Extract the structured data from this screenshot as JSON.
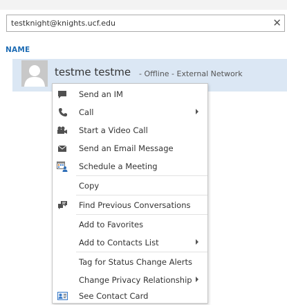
{
  "search": {
    "value": "testknight@knights.ucf.edu",
    "clear_glyph": "✕"
  },
  "section": {
    "title": "NAME"
  },
  "contact": {
    "name": "testme testme",
    "status": "- Offline - External Network"
  },
  "menu": {
    "items": [
      {
        "label": "Send an IM",
        "icon": "chat-icon",
        "submenu": false
      },
      {
        "label": "Call",
        "icon": "phone-icon",
        "submenu": true
      },
      {
        "label": "Start a Video Call",
        "icon": "video-camera-icon",
        "submenu": false
      },
      {
        "label": "Send an Email Message",
        "icon": "envelope-icon",
        "submenu": false
      },
      {
        "label": "Schedule a Meeting",
        "icon": "calendar-meeting-icon",
        "submenu": false
      },
      {
        "label": "Copy",
        "icon": "",
        "submenu": false
      },
      {
        "label": "Find Previous Conversations",
        "icon": "conversation-history-icon",
        "submenu": false
      },
      {
        "label": "Add to Favorites",
        "icon": "",
        "submenu": false
      },
      {
        "label": "Add to Contacts List",
        "icon": "",
        "submenu": true
      },
      {
        "label": "Tag for Status Change Alerts",
        "icon": "",
        "submenu": false
      },
      {
        "label": "Change Privacy Relationship",
        "icon": "",
        "submenu": true
      },
      {
        "label": "See Contact Card",
        "icon": "contact-card-icon",
        "submenu": false
      }
    ]
  },
  "colors": {
    "accent": "#1e6cb4",
    "selection": "#dbe7f4",
    "icon": "#505050"
  }
}
